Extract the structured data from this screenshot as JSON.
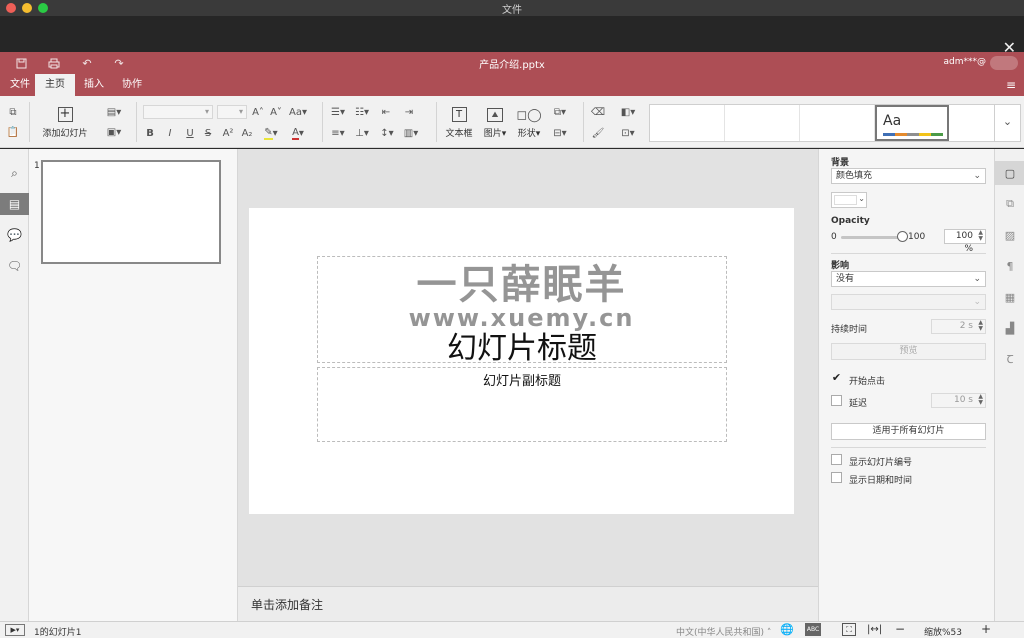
{
  "os_window": {
    "title": "文件"
  },
  "app": {
    "document_title": "产品介绍.pptx",
    "user": "adm***@"
  },
  "menu_tabs": [
    {
      "label": "文件"
    },
    {
      "label": "主页"
    },
    {
      "label": "插入"
    },
    {
      "label": "协作"
    }
  ],
  "toolbar": {
    "add_slide_label": "添加幻灯片",
    "textbox_label": "文本框",
    "picture_label": "图片",
    "shape_label": "形状",
    "theme_sample": "Aa"
  },
  "slide_panel": {
    "slide_number": "1"
  },
  "slide": {
    "title": "幻灯片标题",
    "subtitle": "幻灯片副标题",
    "watermark_line1": "一只薛眠羊",
    "watermark_line2": "www.xuemy.cn"
  },
  "notes": {
    "placeholder": "单击添加备注"
  },
  "right_panel": {
    "background_label": "背景",
    "fill_select": "颜色填充",
    "opacity_label": "Opacity",
    "opacity_min": "0",
    "opacity_max": "100",
    "opacity_value": "100 %",
    "opacity_fraction": 1.0,
    "transition_label": "影响",
    "transition_select": "没有",
    "duration_label": "持续时间",
    "duration_value": "2 s",
    "preview_button": "预览",
    "start_on_click_label": "开始点击",
    "start_on_click_checked": true,
    "delay_label": "延迟",
    "delay_checked": false,
    "delay_value": "10 s",
    "apply_all_button": "适用于所有幻灯片",
    "show_slide_number_label": "显示幻灯片编号",
    "show_datetime_label": "显示日期和时间"
  },
  "statusbar": {
    "slide_info": "1的幻灯片1",
    "language": "中文(中华人民共和国)",
    "zoom": "缩放%53"
  },
  "colors": {
    "accent": "#ad4e55",
    "toolbar_bg": "#f1f1f1",
    "canvas_bg": "#e2e2e2"
  }
}
